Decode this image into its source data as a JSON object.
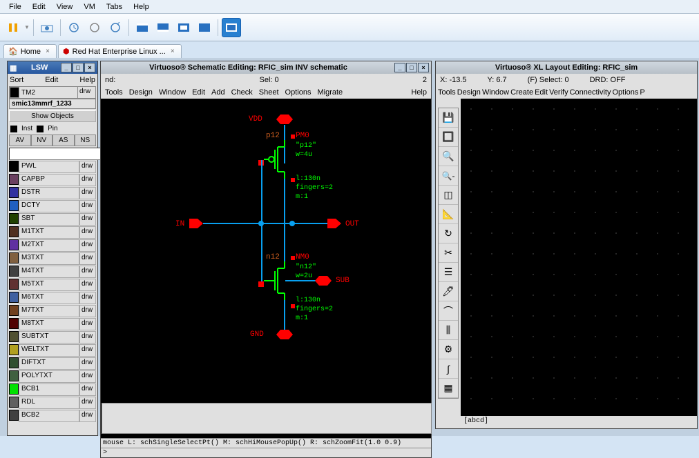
{
  "menubar": {
    "items": [
      "File",
      "Edit",
      "View",
      "VM",
      "Tabs",
      "Help"
    ]
  },
  "tabs": [
    {
      "icon": "home",
      "label": "Home"
    },
    {
      "icon": "rh",
      "label": "Red Hat Enterprise Linux ..."
    }
  ],
  "lsw": {
    "title": "LSW",
    "menu": {
      "sort": "Sort",
      "edit": "Edit",
      "help": "Help"
    },
    "current": {
      "name": "TM2",
      "drv": "drw"
    },
    "lib": "smic13mmrf_1233",
    "show_objects": "Show Objects",
    "inst": "Inst",
    "pin": "Pin",
    "buttons": [
      "AV",
      "NV",
      "AS",
      "NS"
    ],
    "layers": [
      {
        "name": "PWL",
        "color": "#000000",
        "drv": "drw"
      },
      {
        "name": "CAPBP",
        "color": "#6a4060",
        "drv": "drw"
      },
      {
        "name": "DSTR",
        "color": "#3030a0",
        "drv": "drw"
      },
      {
        "name": "DCTY",
        "color": "#2060c0",
        "drv": "drw"
      },
      {
        "name": "SBT",
        "color": "#204000",
        "drv": "drw"
      },
      {
        "name": "M1TXT",
        "color": "#503020",
        "drv": "drw"
      },
      {
        "name": "M2TXT",
        "color": "#6030a0",
        "drv": "drw"
      },
      {
        "name": "M3TXT",
        "color": "#806040",
        "drv": "drw"
      },
      {
        "name": "M4TXT",
        "color": "#404040",
        "drv": "drw"
      },
      {
        "name": "M5TXT",
        "color": "#603030",
        "drv": "drw"
      },
      {
        "name": "M6TXT",
        "color": "#4060a0",
        "drv": "drw"
      },
      {
        "name": "M7TXT",
        "color": "#704020",
        "drv": "drw"
      },
      {
        "name": "M8TXT",
        "color": "#500000",
        "drv": "drw"
      },
      {
        "name": "SUBTXT",
        "color": "#505030",
        "drv": "drw"
      },
      {
        "name": "WELTXT",
        "color": "#b0a020",
        "drv": "drw"
      },
      {
        "name": "DIFTXT",
        "color": "#305030",
        "drv": "drw"
      },
      {
        "name": "POLYTXT",
        "color": "#406040",
        "drv": "drw"
      },
      {
        "name": "BCB1",
        "color": "#00e000",
        "drv": "drw"
      },
      {
        "name": "RDL",
        "color": "#606060",
        "drv": "drw"
      },
      {
        "name": "BCB2",
        "color": "#404040",
        "drv": "drw"
      }
    ]
  },
  "schematic": {
    "title": "Virtuoso® Schematic Editing: RFIC_sim INV schematic",
    "info_left": "nd:",
    "info_sel": "Sel: 0",
    "info_right": "2",
    "menu": [
      "Tools",
      "Design",
      "Window",
      "Edit",
      "Add",
      "Check",
      "Sheet",
      "Options",
      "Migrate"
    ],
    "help": "Help",
    "labels": {
      "vdd": "VDD",
      "in": "IN",
      "out": "OUT",
      "gnd": "GND",
      "sub": "SUB",
      "pm0": "PM0",
      "nm0": "NM0",
      "p12": "p12",
      "n12": "n12",
      "pprops": "\"p12\"\nw=4u",
      "pprops2": "l:130n\nfingers=2\nm:1",
      "nprops": "\"n12\"\nw=2u",
      "nprops2": "l:130n\nfingers=2\nm:1"
    },
    "status": "mouse L: schSingleSelectPt() M: schHiMousePopUp()   R: schZoomFit(1.0 0.9)",
    "prompt": ">"
  },
  "layout": {
    "title": "Virtuoso® XL Layout Editing: RFIC_sim",
    "info": {
      "x": "X: -13.5",
      "y": "Y: 6.7",
      "sel": "(F) Select: 0",
      "drd": "DRD: OFF"
    },
    "menu": [
      "Tools",
      "Design",
      "Window",
      "Create",
      "Edit",
      "Verify",
      "Connectivity",
      "Options",
      "P"
    ],
    "bottom_label": "[abcd]"
  }
}
